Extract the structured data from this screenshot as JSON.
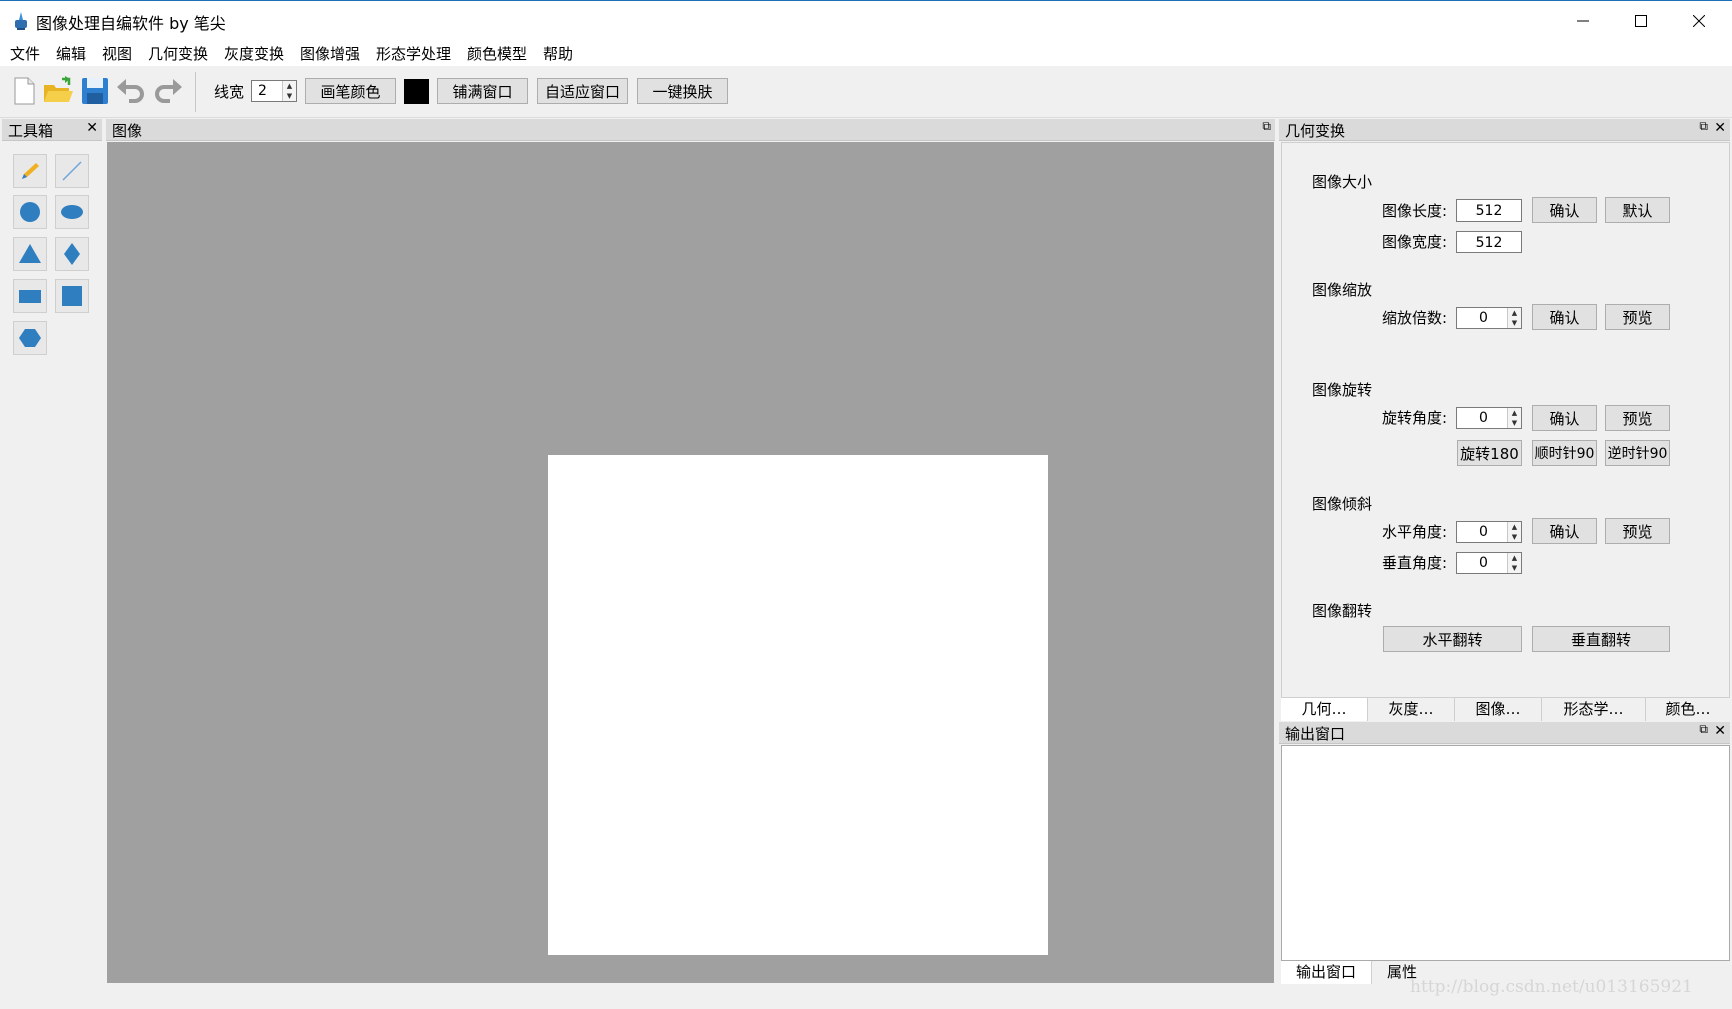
{
  "window": {
    "title": "图像处理自编软件 by 笔尖",
    "minimize": "—",
    "maximize": "☐",
    "close": "✕"
  },
  "menu": [
    "文件",
    "编辑",
    "视图",
    "几何变换",
    "灰度变换",
    "图像增强",
    "形态学处理",
    "颜色模型",
    "帮助"
  ],
  "toolbar": {
    "icons": [
      "new-file-icon",
      "open-folder-icon",
      "save-icon",
      "undo-icon",
      "redo-icon"
    ],
    "line_width_label": "线宽",
    "line_width_value": "2",
    "pen_color_label": "画笔颜色",
    "pen_color": "#000000",
    "fill_window_label": "铺满窗口",
    "fit_window_label": "自适应窗口",
    "skin_label": "一键换肤"
  },
  "toolbox": {
    "title": "工具箱",
    "close": "✕",
    "tools": [
      "pen-tool",
      "line-tool",
      "circle-tool",
      "ellipse-tool",
      "triangle-tool",
      "diamond-tool",
      "rectangle-tool",
      "square-tool",
      "hexagon-tool"
    ]
  },
  "image_dock": {
    "title": "图像",
    "canvas_color": "#ffffff",
    "background": "#a0a0a0"
  },
  "geometry": {
    "title": "几何变换",
    "size": {
      "section": "图像大小",
      "length_label": "图像长度:",
      "length_value": "512",
      "width_label": "图像宽度:",
      "width_value": "512",
      "confirm": "确认",
      "default": "默认"
    },
    "scale": {
      "section": "图像缩放",
      "factor_label": "缩放倍数:",
      "factor_value": "0",
      "confirm": "确认",
      "preview": "预览"
    },
    "rotate": {
      "section": "图像旋转",
      "angle_label": "旋转角度:",
      "angle_value": "0",
      "confirm": "确认",
      "preview": "预览",
      "rot180": "旋转180",
      "cw90": "顺时针90",
      "ccw90": "逆时针90"
    },
    "shear": {
      "section": "图像倾斜",
      "h_label": "水平角度:",
      "h_value": "0",
      "v_label": "垂直角度:",
      "v_value": "0",
      "confirm": "确认",
      "preview": "预览"
    },
    "flip": {
      "section": "图像翻转",
      "horizontal": "水平翻转",
      "vertical": "垂直翻转"
    },
    "tabs": [
      "几何…",
      "灰度…",
      "图像…",
      "形态学…",
      "颜色…"
    ]
  },
  "output": {
    "title": "输出窗口",
    "tabs": [
      "输出窗口",
      "属性"
    ]
  },
  "watermark": "http://blog.csdn.net/u013165921"
}
